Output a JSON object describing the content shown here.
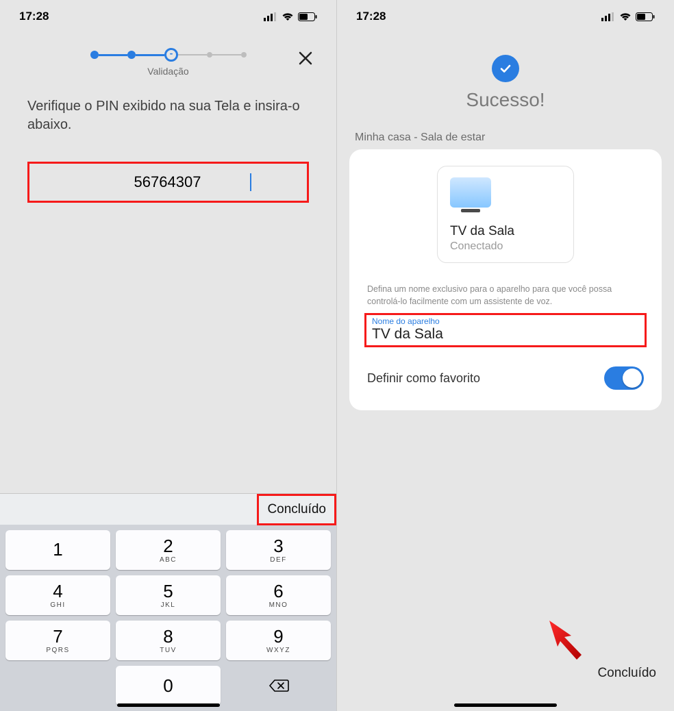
{
  "status_bar": {
    "time": "17:28"
  },
  "left": {
    "step_label": "Validação",
    "instruction": "Verifique o PIN exibido na sua Tela e insira-o abaixo.",
    "pin_value": "56764307",
    "keyboard_done": "Concluído",
    "keys": [
      {
        "num": "1",
        "letters": ""
      },
      {
        "num": "2",
        "letters": "ABC"
      },
      {
        "num": "3",
        "letters": "DEF"
      },
      {
        "num": "4",
        "letters": "GHI"
      },
      {
        "num": "5",
        "letters": "JKL"
      },
      {
        "num": "6",
        "letters": "MNO"
      },
      {
        "num": "7",
        "letters": "PQRS"
      },
      {
        "num": "8",
        "letters": "TUV"
      },
      {
        "num": "9",
        "letters": "WXYZ"
      },
      {
        "num": "",
        "letters": ""
      },
      {
        "num": "0",
        "letters": ""
      }
    ]
  },
  "right": {
    "success_title": "Sucesso!",
    "location": "Minha casa - Sala de estar",
    "device_name": "TV da Sala",
    "device_status": "Conectado",
    "hint": "Defina um nome exclusivo para o aparelho para que você possa controlá-lo facilmente com um assistente de voz.",
    "name_field_label": "Nome do aparelho",
    "name_field_value": "TV da Sala",
    "favorite_label": "Definir como favorito",
    "favorite_on": true,
    "done_button": "Concluído"
  }
}
